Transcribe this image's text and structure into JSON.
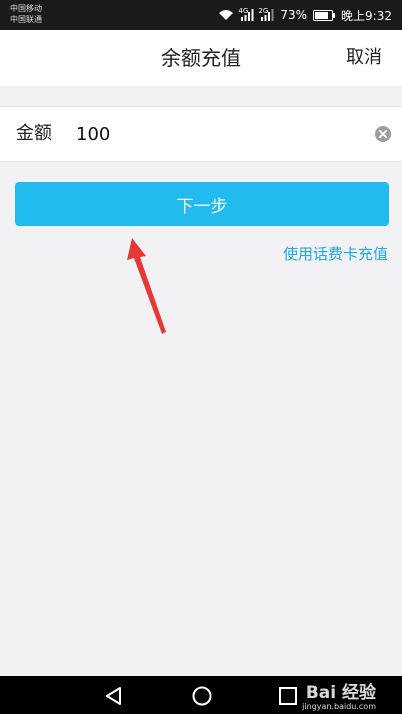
{
  "status_bar": {
    "carrier_1": "中国移动",
    "carrier_2": "中国联通",
    "network_1": "4G",
    "network_2": "2G",
    "battery": "73%",
    "time": "晚上9:32"
  },
  "header": {
    "title": "余额充值",
    "cancel_label": "取消"
  },
  "form": {
    "amount_label": "金额",
    "amount_value": "100"
  },
  "actions": {
    "next_label": "下一步",
    "phonecard_link": "使用话费卡充值"
  },
  "watermark": {
    "brand": "Bai 经验",
    "url": "jingyan.baidu.com"
  },
  "colors": {
    "accent": "#21bbee",
    "link": "#1fa7e0",
    "background": "#f2f2f4",
    "annotation": "#e53935"
  },
  "icons": {
    "clear": "clear-circle-icon",
    "back": "triangle-back-icon",
    "home": "circle-home-icon",
    "recent": "square-recent-icon"
  }
}
